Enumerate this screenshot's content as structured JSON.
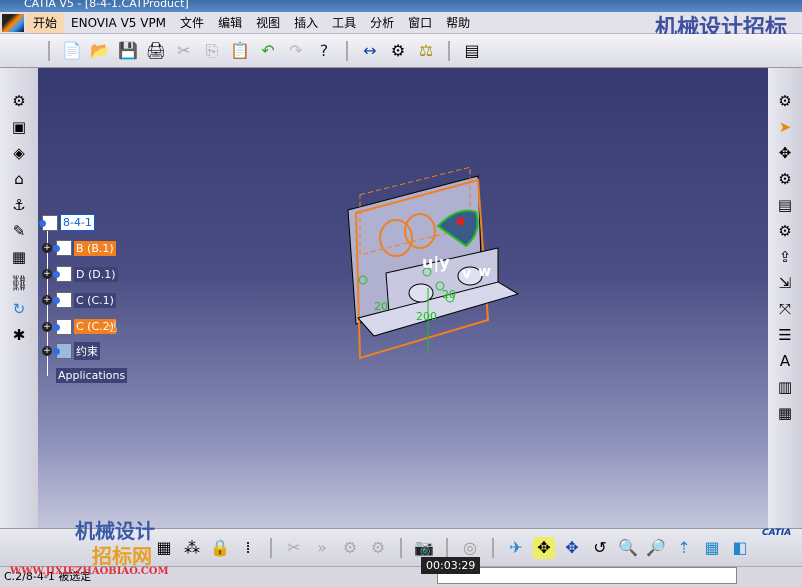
{
  "window": {
    "title": "CATIA V5 - [8-4-1.CATProduct]"
  },
  "menu": {
    "items": [
      "开始",
      "ENOVIA V5 VPM",
      "文件",
      "编辑",
      "视图",
      "插入",
      "工具",
      "分析",
      "窗口",
      "帮助"
    ]
  },
  "toolbar": {
    "icons": [
      "new-icon",
      "open-icon",
      "save-icon",
      "print-icon",
      "cut-icon",
      "copy-icon",
      "paste-icon",
      "undo-icon",
      "redo-icon",
      "whats-this-icon",
      "measure-between-icon",
      "measure-item-icon",
      "measure-inertia-icon",
      "catalog-icon"
    ]
  },
  "tree": {
    "root": "8-4-1",
    "children": [
      {
        "label": "B (B.1)",
        "selected": true
      },
      {
        "label": "D (D.1)",
        "selected": false
      },
      {
        "label": "C (C.1)",
        "selected": false
      },
      {
        "label": "C (C.2)",
        "selected": true
      },
      {
        "label": "约束",
        "selected": false
      }
    ],
    "applications": "Applications"
  },
  "viewport": {
    "labels": [
      "u|y",
      "v",
      "w",
      "20",
      "20",
      "200"
    ]
  },
  "status": {
    "text": "C.2/8-4-1 被选定",
    "timer": "00:03:29"
  },
  "watermark": {
    "top": "机械设计招标网",
    "url": "WWW.JIXIEZHAOBIAO.COM",
    "bottom1": "机械设计",
    "bottom2": "招标网"
  },
  "brand": {
    "catia": "CATIA"
  },
  "colors": {
    "selection": "#f08020",
    "background_top": "#363a6e",
    "constraint": "#20c020"
  }
}
